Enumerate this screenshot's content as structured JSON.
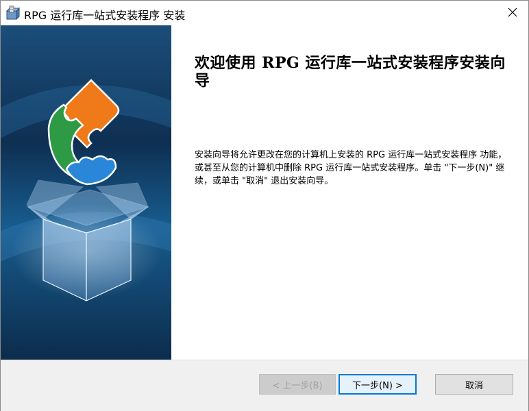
{
  "window": {
    "title": "RPG 运行库一站式安装程序 安装",
    "close_glyph": "✕"
  },
  "welcome": {
    "heading": "欢迎使用 RPG 运行库一站式安装程序安装向导",
    "description": "安装向导将允许更改在您的计算机上安装的 RPG 运行库一站式安装程序 功能，或甚至从您的计算机中删除 RPG 运行库一站式安装程序。单击 \"下一步(N)\" 继续，或单击 \"取消\" 退出安装向导。"
  },
  "buttons": {
    "back": "< 上一步(B)",
    "next": "下一步(N) >",
    "cancel": "取消"
  },
  "colors": {
    "accent": "#0078d7",
    "banner_dark": "#0d2f4f",
    "banner_mid": "#1f5f8f",
    "puzzle_orange": "#f07a1a",
    "puzzle_green": "#2e9a46",
    "puzzle_blue": "#2a86d8"
  },
  "icons": {
    "app": "installer-box-icon",
    "close": "close-icon",
    "banner": "puzzle-box-illustration"
  }
}
